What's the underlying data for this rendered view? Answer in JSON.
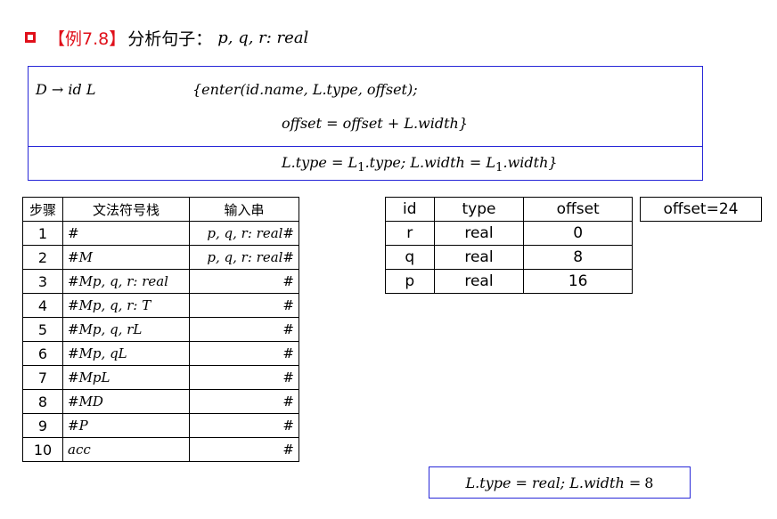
{
  "title": {
    "tag": "【例7.8】",
    "text": "分析句子：",
    "sentence": "p, q, r: real"
  },
  "rule": {
    "production": "D → id L",
    "action_line1": "{enter(id.name, L.type, offset);",
    "action_line2": "offset = offset + L.width}",
    "line3_a": "L.type = L",
    "line3_sub1": "1",
    "line3_b": ".type; L.width = L",
    "line3_sub2": "1",
    "line3_c": ".width}"
  },
  "steps_table": {
    "headers": [
      "步骤",
      "文法符号栈",
      "输入串"
    ],
    "rows": [
      {
        "step": "1",
        "stack": "#",
        "input": "p, q, r: real#"
      },
      {
        "step": "2",
        "stack": "#M",
        "input": "p, q, r: real#"
      },
      {
        "step": "3",
        "stack": "#Mp, q, r: real",
        "input": "#"
      },
      {
        "step": "4",
        "stack": "#Mp, q, r: T",
        "input": "#"
      },
      {
        "step": "5",
        "stack": "#Mp, q, rL",
        "input": "#"
      },
      {
        "step": "6",
        "stack": "#Mp, qL",
        "input": "#"
      },
      {
        "step": "7",
        "stack": "#MpL",
        "input": "#"
      },
      {
        "step": "8",
        "stack": "#MD",
        "input": "#"
      },
      {
        "step": "9",
        "stack": "#P",
        "input": "#"
      },
      {
        "step": "10",
        "stack": "acc",
        "input": "#"
      }
    ]
  },
  "symbol_table": {
    "headers": [
      "id",
      "type",
      "offset"
    ],
    "rows": [
      {
        "id": "r",
        "type": "real",
        "offset": "0"
      },
      {
        "id": "q",
        "type": "real",
        "offset": "8"
      },
      {
        "id": "p",
        "type": "real",
        "offset": "16"
      }
    ]
  },
  "offset_box": "offset=24",
  "result_box": {
    "a": "L.type = real; L.width = ",
    "num": "8"
  },
  "colors": {
    "accent_red": "#e0101a",
    "border_blue": "#2727d8"
  }
}
